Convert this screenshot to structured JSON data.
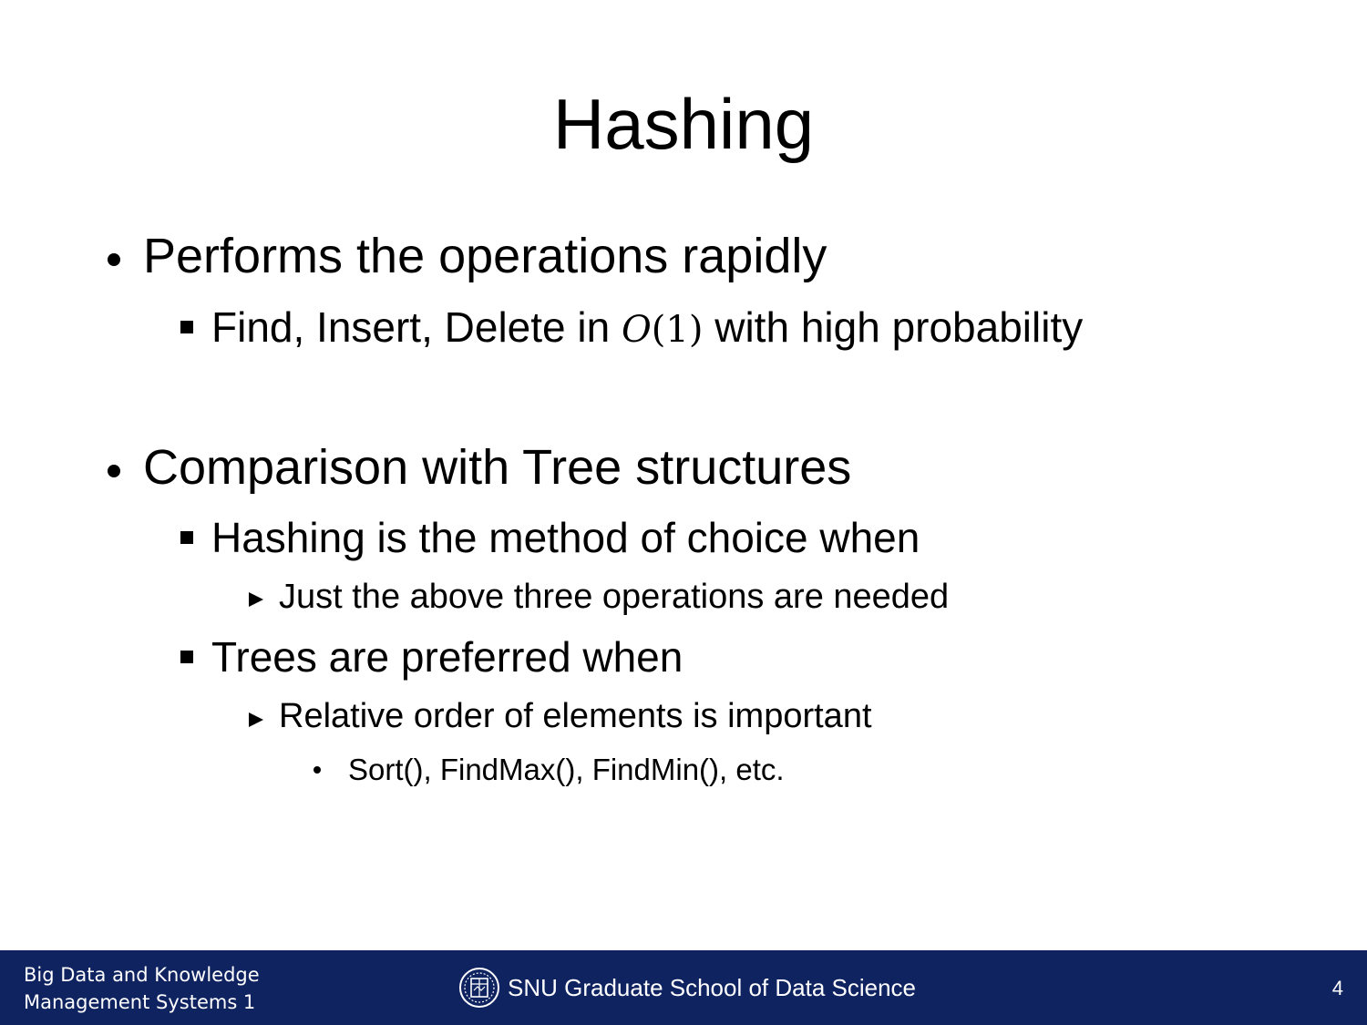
{
  "slide": {
    "title": "Hashing",
    "bullets": [
      {
        "text": "Performs the operations rapidly",
        "sub": [
          {
            "text_before": "Find, Insert, Delete in ",
            "math_o": "O",
            "math_arg": "(1)",
            "text_after": " with high probability"
          }
        ]
      },
      {
        "text": "Comparison with Tree structures",
        "sub": [
          {
            "text": "Hashing is the method of choice when",
            "sub": [
              {
                "text": "Just the above three operations are needed"
              }
            ]
          },
          {
            "text": "Trees are preferred when",
            "sub": [
              {
                "text": "Relative order of elements is important",
                "sub": [
                  {
                    "text": "Sort(), FindMax(), FindMin(), etc."
                  }
                ]
              }
            ]
          }
        ]
      }
    ]
  },
  "footer": {
    "course_line1": "Big Data and Knowledge",
    "course_line2": "Management Systems 1",
    "school": "SNU Graduate School of Data Science",
    "page_number": "4",
    "background_color": "#0f2361",
    "logo_icon": "snu-emblem-icon"
  }
}
